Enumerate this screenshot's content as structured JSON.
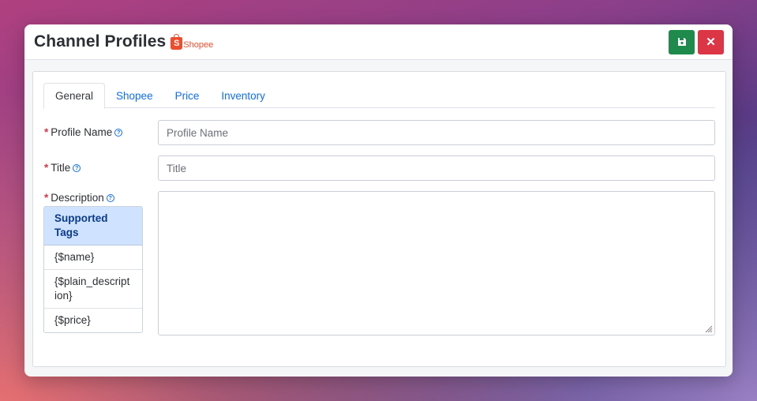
{
  "header": {
    "title": "Channel Profiles",
    "channel_logo_text": "Shopee",
    "channel_logo_glyph": "S"
  },
  "actions": {
    "save_icon": "floppy-disk-icon",
    "close_icon": "close-icon",
    "close_glyph": "✕"
  },
  "tabs": [
    {
      "label": "General",
      "active": true
    },
    {
      "label": "Shopee",
      "active": false
    },
    {
      "label": "Price",
      "active": false
    },
    {
      "label": "Inventory",
      "active": false
    }
  ],
  "form": {
    "required_mark": "*",
    "help_glyph": "?",
    "profile_name": {
      "label": "Profile Name",
      "placeholder": "Profile Name",
      "value": ""
    },
    "title": {
      "label": "Title",
      "placeholder": "Title",
      "value": ""
    },
    "description": {
      "label": "Description",
      "value": ""
    }
  },
  "supported_tags": {
    "heading": "Supported Tags",
    "items": [
      "{$name}",
      "{$plain_description}",
      "{$price}"
    ]
  },
  "colors": {
    "save_button": "#1e8a4c",
    "close_button": "#dc3545",
    "brand_shopee": "#ee4d2d",
    "link": "#0d6efd",
    "required": "#dc3545",
    "tags_header_bg": "#cfe2ff"
  }
}
